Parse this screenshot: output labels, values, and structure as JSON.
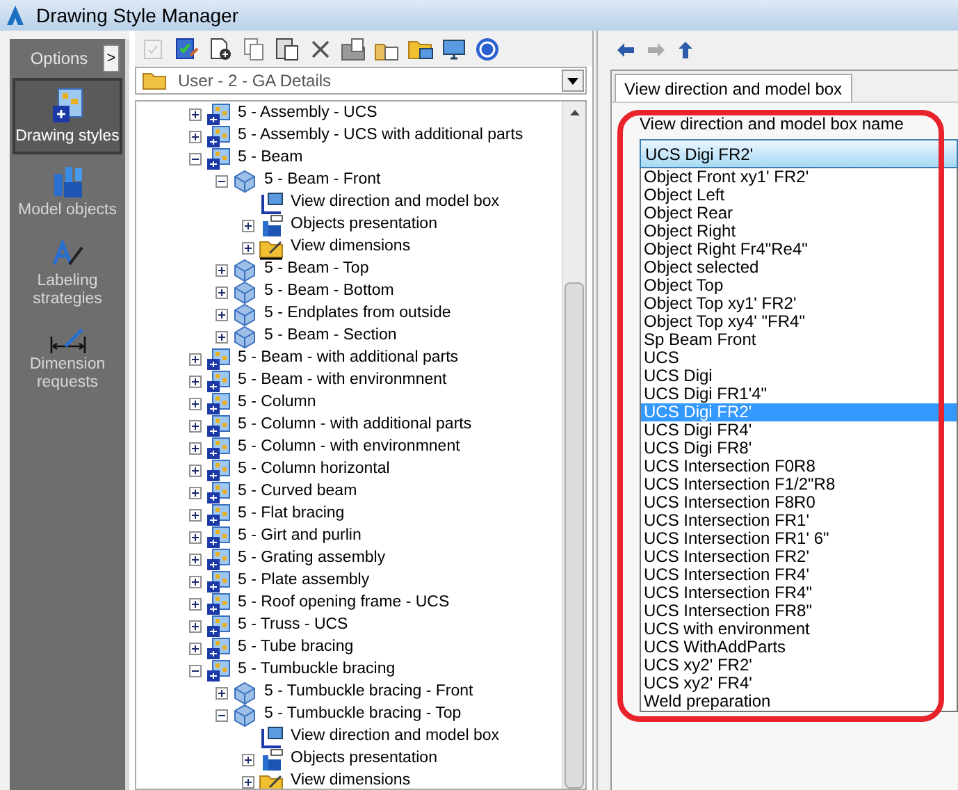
{
  "window": {
    "title": "Drawing Style Manager"
  },
  "sidebar": {
    "options_label": "Options",
    "expand_button": ">",
    "items": [
      {
        "label": "Drawing styles",
        "kind": "styles",
        "selected": true
      },
      {
        "label": "Model objects",
        "kind": "objects",
        "selected": false
      },
      {
        "label": "Labeling strategies",
        "kind": "labeling",
        "selected": false
      },
      {
        "label": "Dimension requests",
        "kind": "dimension",
        "selected": false
      }
    ]
  },
  "toolbar": [
    {
      "kind": "check",
      "disabled": true
    },
    {
      "kind": "edit",
      "disabled": false
    },
    {
      "kind": "new",
      "disabled": false
    },
    {
      "kind": "copy",
      "disabled": false
    },
    {
      "kind": "paste",
      "disabled": false
    },
    {
      "kind": "delete",
      "disabled": false
    },
    {
      "kind": "export",
      "disabled": false
    },
    {
      "kind": "import",
      "disabled": false
    },
    {
      "kind": "folder",
      "disabled": false
    },
    {
      "kind": "screen",
      "disabled": false
    },
    {
      "kind": "help",
      "disabled": false
    }
  ],
  "folder_combo": {
    "value": "User - 2 - GA Details"
  },
  "tree": [
    {
      "label": "5 - Assembly - UCS",
      "kind": "style",
      "expanded": false
    },
    {
      "label": "5 - Assembly - UCS with additional parts",
      "kind": "style",
      "expanded": false
    },
    {
      "label": "5 - Beam",
      "kind": "style",
      "expanded": true,
      "children": [
        {
          "label": "5 - Beam - Front",
          "kind": "view",
          "expanded": true,
          "children": [
            {
              "label": "View direction and model box",
              "kind": "viewdir"
            },
            {
              "label": "Objects presentation",
              "kind": "objects",
              "expanded": false
            },
            {
              "label": "View dimensions",
              "kind": "dimensions",
              "expanded": false
            }
          ]
        },
        {
          "label": "5 - Beam - Top",
          "kind": "view",
          "expanded": false
        },
        {
          "label": "5 - Beam - Bottom",
          "kind": "view",
          "expanded": false
        },
        {
          "label": "5 - Endplates from outside",
          "kind": "view",
          "expanded": false
        },
        {
          "label": "5 - Beam - Section",
          "kind": "view",
          "expanded": false
        }
      ]
    },
    {
      "label": "5 - Beam - with additional parts",
      "kind": "style",
      "expanded": false
    },
    {
      "label": "5 - Beam - with environmnent",
      "kind": "style",
      "expanded": false
    },
    {
      "label": "5 - Column",
      "kind": "style",
      "expanded": false
    },
    {
      "label": "5 - Column - with additional parts",
      "kind": "style",
      "expanded": false
    },
    {
      "label": "5 - Column - with environmnent",
      "kind": "style",
      "expanded": false
    },
    {
      "label": "5 - Column horizontal",
      "kind": "style",
      "expanded": false
    },
    {
      "label": "5 - Curved beam",
      "kind": "style",
      "expanded": false
    },
    {
      "label": "5 - Flat bracing",
      "kind": "style",
      "expanded": false
    },
    {
      "label": "5 - Girt and purlin",
      "kind": "style",
      "expanded": false
    },
    {
      "label": "5 - Grating assembly",
      "kind": "style",
      "expanded": false
    },
    {
      "label": "5 - Plate assembly",
      "kind": "style",
      "expanded": false
    },
    {
      "label": "5 - Roof opening frame - UCS",
      "kind": "style",
      "expanded": false
    },
    {
      "label": "5 - Truss - UCS",
      "kind": "style",
      "expanded": false
    },
    {
      "label": "5 - Tube bracing",
      "kind": "style",
      "expanded": false
    },
    {
      "label": "5 - Tumbuckle bracing",
      "kind": "style",
      "expanded": true,
      "children": [
        {
          "label": "5 - Tumbuckle bracing - Front",
          "kind": "view",
          "expanded": false
        },
        {
          "label": "5 - Tumbuckle bracing - Top",
          "kind": "view",
          "expanded": true,
          "children": [
            {
              "label": "View direction and model box",
              "kind": "viewdir"
            },
            {
              "label": "Objects presentation",
              "kind": "objects",
              "expanded": false
            },
            {
              "label": "View dimensions",
              "kind": "dimensions",
              "expanded": false
            }
          ]
        }
      ]
    }
  ],
  "tab": {
    "label": "View direction and model box",
    "selected": true
  },
  "group_label": "View direction and model box name",
  "name_combo": {
    "value": "UCS Digi FR2'"
  },
  "dropdown_options": [
    {
      "label": "Object Front xy1' FR2'",
      "selected": false
    },
    {
      "label": "Object Left",
      "selected": false
    },
    {
      "label": "Object Rear",
      "selected": false
    },
    {
      "label": "Object Right",
      "selected": false
    },
    {
      "label": "Object Right Fr4\"Re4\"",
      "selected": false
    },
    {
      "label": "Object selected",
      "selected": false
    },
    {
      "label": "Object Top",
      "selected": false
    },
    {
      "label": "Object Top xy1' FR2'",
      "selected": false
    },
    {
      "label": "Object Top xy4' \"FR4\"",
      "selected": false
    },
    {
      "label": "Sp Beam Front",
      "selected": false
    },
    {
      "label": "UCS",
      "selected": false
    },
    {
      "label": "UCS Digi",
      "selected": false
    },
    {
      "label": "UCS Digi FR1'4\"",
      "selected": false
    },
    {
      "label": "UCS Digi FR2'",
      "selected": true
    },
    {
      "label": "UCS Digi FR4'",
      "selected": false
    },
    {
      "label": "UCS Digi FR8'",
      "selected": false
    },
    {
      "label": "UCS Intersection F0R8",
      "selected": false
    },
    {
      "label": "UCS Intersection F1/2\"R8",
      "selected": false
    },
    {
      "label": "UCS Intersection F8R0",
      "selected": false
    },
    {
      "label": "UCS Intersection FR1'",
      "selected": false
    },
    {
      "label": "UCS Intersection FR1' 6\"",
      "selected": false
    },
    {
      "label": "UCS Intersection FR2'",
      "selected": false
    },
    {
      "label": "UCS Intersection FR4'",
      "selected": false
    },
    {
      "label": "UCS Intersection FR4\"",
      "selected": false
    },
    {
      "label": "UCS Intersection FR8\"",
      "selected": false
    },
    {
      "label": "UCS with environment",
      "selected": false
    },
    {
      "label": "UCS WithAddParts",
      "selected": false
    },
    {
      "label": "UCS xy2' FR2'",
      "selected": false
    },
    {
      "label": "UCS xy2' FR4'",
      "selected": false
    },
    {
      "label": "Weld preparation",
      "selected": false
    }
  ]
}
